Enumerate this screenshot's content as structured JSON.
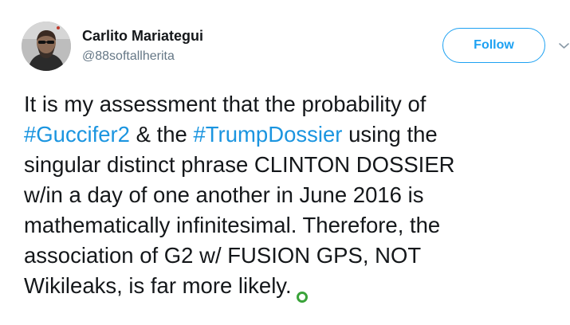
{
  "user": {
    "display_name": "Carlito Mariategui",
    "handle": "@88softallherita",
    "avatar_icon": "user-avatar"
  },
  "follow": {
    "label": "Follow"
  },
  "menu": {
    "caret_icon": "chevron-down-icon"
  },
  "tweet": {
    "line1": "It is my assessment that the probability of",
    "hashtag1": "#Guccifer2",
    "line2_mid": " & the ",
    "hashtag2": "#TrumpDossier",
    "line2_end": " using the",
    "line3": "singular distinct phrase CLINTON DOSSIER",
    "line4": "w/in a day of one another in June 2016 is",
    "line5": "mathematically infinitesimal. Therefore, the",
    "line6": "association of G2 w/ FUSION GPS, NOT",
    "line7": "Wikileaks, is far more likely.",
    "trailing_icon": "green-circle-emoji-icon"
  },
  "colors": {
    "link": "#1b95e0",
    "follow_border": "#1da1f2",
    "text": "#14171a",
    "muted": "#657786"
  }
}
